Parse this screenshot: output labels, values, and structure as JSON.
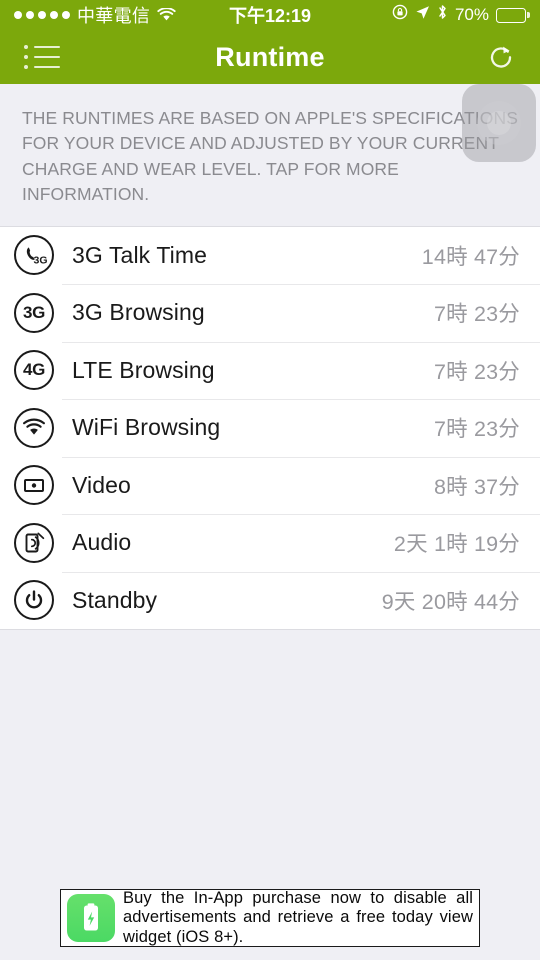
{
  "status_bar": {
    "carrier": "中華電信",
    "time": "下午12:19",
    "battery_percent": "70%",
    "battery_level": 70,
    "signal_bars": 5,
    "icons": [
      "signal-dots",
      "wifi-icon",
      "rotation-lock-icon",
      "location-arrow-icon",
      "bluetooth-icon",
      "battery-icon"
    ]
  },
  "nav_bar": {
    "title": "Runtime",
    "menu_icon": "list-menu-icon",
    "refresh_icon": "refresh-icon",
    "background_color": "#7CA80C"
  },
  "info_banner": {
    "text": "THE RUNTIMES ARE BASED ON APPLE'S SPECIFICATIONS FOR YOUR DEVICE AND ADJUSTED BY YOUR CURRENT CHARGE AND WEAR LEVEL. TAP FOR MORE INFORMATION."
  },
  "runtime_list": {
    "rows": [
      {
        "icon": "phone-3g-icon",
        "label": "3G Talk Time",
        "value": "14時 47分"
      },
      {
        "icon": "3g-badge-icon",
        "label": "3G Browsing",
        "value": "7時 23分"
      },
      {
        "icon": "4g-badge-icon",
        "label": "LTE Browsing",
        "value": "7時 23分"
      },
      {
        "icon": "wifi-icon",
        "label": "WiFi Browsing",
        "value": "7時 23分"
      },
      {
        "icon": "video-icon",
        "label": "Video",
        "value": "8時 37分"
      },
      {
        "icon": "audio-icon",
        "label": "Audio",
        "value": "2天 1時 19分"
      },
      {
        "icon": "power-icon",
        "label": "Standby",
        "value": "9天 20時 44分"
      }
    ]
  },
  "ad_banner": {
    "text": "Buy the In-App purchase now to disable all advertisements and retrieve a free today view widget (iOS 8+).",
    "icon": "battery-charging-app-icon",
    "icon_color": "#4BD964"
  },
  "assistive_touch": {
    "icon": "assistive-touch-icon"
  },
  "colors": {
    "accent": "#7CA80C",
    "background": "#EFEFF4",
    "list_background": "#FFFFFF",
    "value_text": "#9A9A9F",
    "label_text": "#1A1A1A"
  }
}
